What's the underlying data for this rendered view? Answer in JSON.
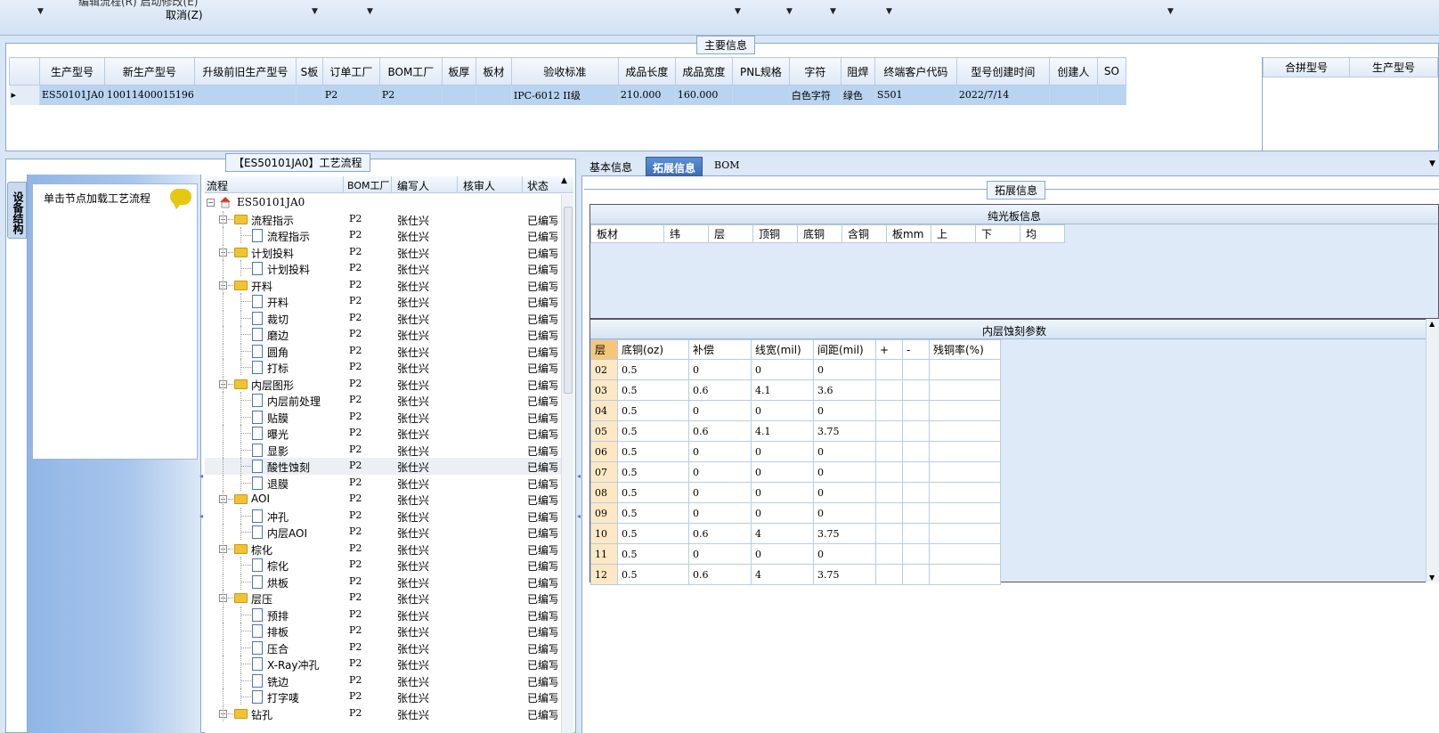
{
  "topbar": {
    "cut_menu": "编辑流程(R)    启动修改(E)",
    "cancel_menu": "取消(Z)"
  },
  "main_info": {
    "title": "主要信息",
    "columns": [
      "生产型号",
      "新生产型号",
      "升级前旧生产型号",
      "S板",
      "订单工厂",
      "BOM工厂",
      "板厚",
      "板材",
      "验收标准",
      "成品长度",
      "成品宽度",
      "PNL规格",
      "字符",
      "阻焊",
      "终端客户代码",
      "型号创建时间",
      "创建人",
      "SO"
    ],
    "row": [
      "ES50101JA0",
      "10011400015196",
      "",
      "",
      "P2",
      "P2",
      "",
      "",
      "IPC-6012 II级",
      "210.000",
      "160.000",
      "",
      "白色字符",
      "绿色",
      "S501",
      "2022/7/14",
      "",
      ""
    ],
    "merge_columns": [
      "合拼型号",
      "生产型号"
    ]
  },
  "flow_panel": {
    "title": "【ES50101JA0】工艺流程",
    "side_tab": "设备结构",
    "load_hint": "单击节点加载工艺流程",
    "headers": [
      "流程",
      "BOM工厂",
      "编写人",
      "核审人",
      "状态"
    ],
    "rows": [
      {
        "name": "ES50101JA0",
        "level": 0,
        "type": "root",
        "bom": "",
        "author": "",
        "status": ""
      },
      {
        "name": "流程指示",
        "level": 1,
        "type": "folder",
        "bom": "P2",
        "author": "张仕兴",
        "status": "已编写"
      },
      {
        "name": "流程指示",
        "level": 2,
        "type": "doc",
        "bom": "P2",
        "author": "张仕兴",
        "status": "已编写"
      },
      {
        "name": "计划投料",
        "level": 1,
        "type": "folder",
        "bom": "P2",
        "author": "张仕兴",
        "status": "已编写"
      },
      {
        "name": "计划投料",
        "level": 2,
        "type": "doc",
        "bom": "P2",
        "author": "张仕兴",
        "status": "已编写"
      },
      {
        "name": "开料",
        "level": 1,
        "type": "folder",
        "bom": "P2",
        "author": "张仕兴",
        "status": "已编写"
      },
      {
        "name": "开料",
        "level": 2,
        "type": "doc",
        "bom": "P2",
        "author": "张仕兴",
        "status": "已编写"
      },
      {
        "name": "裁切",
        "level": 2,
        "type": "doc",
        "bom": "P2",
        "author": "张仕兴",
        "status": "已编写"
      },
      {
        "name": "磨边",
        "level": 2,
        "type": "doc",
        "bom": "P2",
        "author": "张仕兴",
        "status": "已编写"
      },
      {
        "name": "圆角",
        "level": 2,
        "type": "doc",
        "bom": "P2",
        "author": "张仕兴",
        "status": "已编写"
      },
      {
        "name": "打标",
        "level": 2,
        "type": "doc",
        "bom": "P2",
        "author": "张仕兴",
        "status": "已编写"
      },
      {
        "name": "内层图形",
        "level": 1,
        "type": "folder",
        "bom": "P2",
        "author": "张仕兴",
        "status": "已编写"
      },
      {
        "name": "内层前处理",
        "level": 2,
        "type": "doc",
        "bom": "P2",
        "author": "张仕兴",
        "status": "已编写"
      },
      {
        "name": "贴膜",
        "level": 2,
        "type": "doc",
        "bom": "P2",
        "author": "张仕兴",
        "status": "已编写"
      },
      {
        "name": "曝光",
        "level": 2,
        "type": "doc",
        "bom": "P2",
        "author": "张仕兴",
        "status": "已编写"
      },
      {
        "name": "显影",
        "level": 2,
        "type": "doc",
        "bom": "P2",
        "author": "张仕兴",
        "status": "已编写"
      },
      {
        "name": "酸性蚀刻",
        "level": 2,
        "type": "doc",
        "bom": "P2",
        "author": "张仕兴",
        "status": "已编写",
        "selected": true
      },
      {
        "name": "退膜",
        "level": 2,
        "type": "doc",
        "bom": "P2",
        "author": "张仕兴",
        "status": "已编写"
      },
      {
        "name": "AOI",
        "level": 1,
        "type": "folder",
        "bom": "P2",
        "author": "张仕兴",
        "status": "已编写"
      },
      {
        "name": "冲孔",
        "level": 2,
        "type": "doc",
        "bom": "P2",
        "author": "张仕兴",
        "status": "已编写"
      },
      {
        "name": "内层AOI",
        "level": 2,
        "type": "doc",
        "bom": "P2",
        "author": "张仕兴",
        "status": "已编写"
      },
      {
        "name": "棕化",
        "level": 1,
        "type": "folder",
        "bom": "P2",
        "author": "张仕兴",
        "status": "已编写"
      },
      {
        "name": "棕化",
        "level": 2,
        "type": "doc",
        "bom": "P2",
        "author": "张仕兴",
        "status": "已编写"
      },
      {
        "name": "烘板",
        "level": 2,
        "type": "doc",
        "bom": "P2",
        "author": "张仕兴",
        "status": "已编写"
      },
      {
        "name": "层压",
        "level": 1,
        "type": "folder",
        "bom": "P2",
        "author": "张仕兴",
        "status": "已编写"
      },
      {
        "name": "预排",
        "level": 2,
        "type": "doc",
        "bom": "P2",
        "author": "张仕兴",
        "status": "已编写"
      },
      {
        "name": "排板",
        "level": 2,
        "type": "doc",
        "bom": "P2",
        "author": "张仕兴",
        "status": "已编写"
      },
      {
        "name": "压合",
        "level": 2,
        "type": "doc",
        "bom": "P2",
        "author": "张仕兴",
        "status": "已编写"
      },
      {
        "name": "X-Ray冲孔",
        "level": 2,
        "type": "doc",
        "bom": "P2",
        "author": "张仕兴",
        "status": "已编写"
      },
      {
        "name": "铣边",
        "level": 2,
        "type": "doc",
        "bom": "P2",
        "author": "张仕兴",
        "status": "已编写"
      },
      {
        "name": "打字唛",
        "level": 2,
        "type": "doc",
        "bom": "P2",
        "author": "张仕兴",
        "status": "已编写"
      },
      {
        "name": "钻孔",
        "level": 1,
        "type": "folder",
        "bom": "P2",
        "author": "张仕兴",
        "status": "已编写"
      }
    ]
  },
  "right_panel": {
    "tabs": [
      "基本信息",
      "拓展信息",
      "BOM"
    ],
    "active_tab": 1,
    "ext_title": "拓展信息",
    "plain_board": {
      "title": "纯光板信息",
      "columns": [
        "板材",
        "纬",
        "层",
        "顶铜",
        "底铜",
        "含铜",
        "板mm",
        "上",
        "下",
        "均"
      ]
    },
    "inner_etch": {
      "title": "内层蚀刻参数",
      "columns": [
        "层",
        "底铜(oz)",
        "补偿",
        "线宽(mil)",
        "间距(mil)",
        "+",
        "-",
        "残铜率(%)"
      ],
      "rows": [
        [
          "02",
          "0.5",
          "0",
          "0",
          "0",
          "",
          "",
          ""
        ],
        [
          "03",
          "0.5",
          "0.6",
          "4.1",
          "3.6",
          "",
          "",
          ""
        ],
        [
          "04",
          "0.5",
          "0",
          "0",
          "0",
          "",
          "",
          ""
        ],
        [
          "05",
          "0.5",
          "0.6",
          "4.1",
          "3.75",
          "",
          "",
          ""
        ],
        [
          "06",
          "0.5",
          "0",
          "0",
          "0",
          "",
          "",
          ""
        ],
        [
          "07",
          "0.5",
          "0",
          "0",
          "0",
          "",
          "",
          ""
        ],
        [
          "08",
          "0.5",
          "0",
          "0",
          "0",
          "",
          "",
          ""
        ],
        [
          "09",
          "0.5",
          "0",
          "0",
          "0",
          "",
          "",
          ""
        ],
        [
          "10",
          "0.5",
          "0.6",
          "4",
          "3.75",
          "",
          "",
          ""
        ],
        [
          "11",
          "0.5",
          "0",
          "0",
          "0",
          "",
          "",
          ""
        ],
        [
          "12",
          "0.5",
          "0.6",
          "4",
          "3.75",
          "",
          "",
          ""
        ]
      ]
    }
  }
}
